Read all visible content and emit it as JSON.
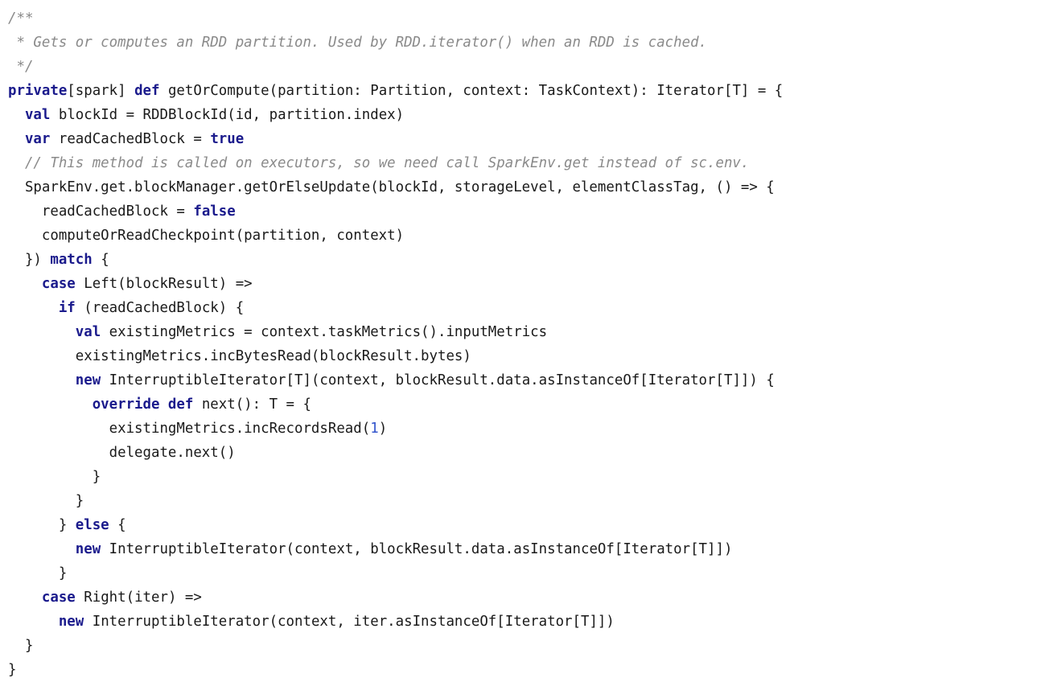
{
  "editor": {
    "language": "Scala",
    "background_color": "#ffffff",
    "colors": {
      "plain": "#1a1a1a",
      "keyword": "#1a1a8c",
      "number": "#3355cc",
      "comment": "#8a8a8a"
    }
  },
  "code": {
    "lines": [
      {
        "id": 1,
        "tokens": [
          {
            "t": "comment",
            "v": "/**"
          }
        ]
      },
      {
        "id": 2,
        "tokens": [
          {
            "t": "comment",
            "v": " * Gets or computes an RDD partition. Used by RDD.iterator() when an RDD is cached."
          }
        ]
      },
      {
        "id": 3,
        "tokens": [
          {
            "t": "comment",
            "v": " */"
          }
        ]
      },
      {
        "id": 4,
        "tokens": [
          {
            "t": "kw",
            "v": "private"
          },
          {
            "t": "plain",
            "v": "[spark] "
          },
          {
            "t": "kw",
            "v": "def"
          },
          {
            "t": "plain",
            "v": " getOrCompute(partition: Partition, context: TaskContext): Iterator[T] = {"
          }
        ]
      },
      {
        "id": 5,
        "tokens": [
          {
            "t": "plain",
            "v": "  "
          },
          {
            "t": "kw",
            "v": "val"
          },
          {
            "t": "plain",
            "v": " blockId = RDDBlockId(id, partition.index)"
          }
        ]
      },
      {
        "id": 6,
        "tokens": [
          {
            "t": "plain",
            "v": "  "
          },
          {
            "t": "kw",
            "v": "var"
          },
          {
            "t": "plain",
            "v": " readCachedBlock = "
          },
          {
            "t": "kw",
            "v": "true"
          }
        ]
      },
      {
        "id": 7,
        "tokens": [
          {
            "t": "plain",
            "v": "  "
          },
          {
            "t": "comment",
            "v": "// This method is called on executors, so we need call SparkEnv.get instead of sc.env."
          }
        ]
      },
      {
        "id": 8,
        "tokens": [
          {
            "t": "plain",
            "v": "  SparkEnv.get.blockManager.getOrElseUpdate(blockId, storageLevel, elementClassTag, () => {"
          }
        ]
      },
      {
        "id": 9,
        "tokens": [
          {
            "t": "plain",
            "v": "    readCachedBlock = "
          },
          {
            "t": "kw",
            "v": "false"
          }
        ]
      },
      {
        "id": 10,
        "tokens": [
          {
            "t": "plain",
            "v": "    computeOrReadCheckpoint(partition, context)"
          }
        ]
      },
      {
        "id": 11,
        "tokens": [
          {
            "t": "plain",
            "v": "  }) "
          },
          {
            "t": "kw",
            "v": "match"
          },
          {
            "t": "plain",
            "v": " {"
          }
        ]
      },
      {
        "id": 12,
        "tokens": [
          {
            "t": "plain",
            "v": "    "
          },
          {
            "t": "kw",
            "v": "case"
          },
          {
            "t": "plain",
            "v": " Left(blockResult) =>"
          }
        ]
      },
      {
        "id": 13,
        "tokens": [
          {
            "t": "plain",
            "v": "      "
          },
          {
            "t": "kw",
            "v": "if"
          },
          {
            "t": "plain",
            "v": " (readCachedBlock) {"
          }
        ]
      },
      {
        "id": 14,
        "tokens": [
          {
            "t": "plain",
            "v": "        "
          },
          {
            "t": "kw",
            "v": "val"
          },
          {
            "t": "plain",
            "v": " existingMetrics = context.taskMetrics().inputMetrics"
          }
        ]
      },
      {
        "id": 15,
        "tokens": [
          {
            "t": "plain",
            "v": "        existingMetrics.incBytesRead(blockResult.bytes)"
          }
        ]
      },
      {
        "id": 16,
        "tokens": [
          {
            "t": "plain",
            "v": "        "
          },
          {
            "t": "kw",
            "v": "new"
          },
          {
            "t": "plain",
            "v": " InterruptibleIterator[T](context, blockResult.data.asInstanceOf[Iterator[T]]) {"
          }
        ]
      },
      {
        "id": 17,
        "tokens": [
          {
            "t": "plain",
            "v": "          "
          },
          {
            "t": "kw",
            "v": "override def"
          },
          {
            "t": "plain",
            "v": " next(): T = {"
          }
        ]
      },
      {
        "id": 18,
        "tokens": [
          {
            "t": "plain",
            "v": "            existingMetrics.incRecordsRead("
          },
          {
            "t": "num",
            "v": "1"
          },
          {
            "t": "plain",
            "v": ")"
          }
        ]
      },
      {
        "id": 19,
        "tokens": [
          {
            "t": "plain",
            "v": "            delegate.next()"
          }
        ]
      },
      {
        "id": 20,
        "tokens": [
          {
            "t": "plain",
            "v": "          }"
          }
        ]
      },
      {
        "id": 21,
        "tokens": [
          {
            "t": "plain",
            "v": "        }"
          }
        ]
      },
      {
        "id": 22,
        "tokens": [
          {
            "t": "plain",
            "v": "      } "
          },
          {
            "t": "kw",
            "v": "else"
          },
          {
            "t": "plain",
            "v": " {"
          }
        ]
      },
      {
        "id": 23,
        "tokens": [
          {
            "t": "plain",
            "v": "        "
          },
          {
            "t": "kw",
            "v": "new"
          },
          {
            "t": "plain",
            "v": " InterruptibleIterator(context, blockResult.data.asInstanceOf[Iterator[T]])"
          }
        ]
      },
      {
        "id": 24,
        "tokens": [
          {
            "t": "plain",
            "v": "      }"
          }
        ]
      },
      {
        "id": 25,
        "tokens": [
          {
            "t": "plain",
            "v": "    "
          },
          {
            "t": "kw",
            "v": "case"
          },
          {
            "t": "plain",
            "v": " Right(iter) =>"
          }
        ]
      },
      {
        "id": 26,
        "tokens": [
          {
            "t": "plain",
            "v": "      "
          },
          {
            "t": "kw",
            "v": "new"
          },
          {
            "t": "plain",
            "v": " InterruptibleIterator(context, iter.asInstanceOf[Iterator[T]])"
          }
        ]
      },
      {
        "id": 27,
        "tokens": [
          {
            "t": "plain",
            "v": "  }"
          }
        ]
      },
      {
        "id": 28,
        "tokens": [
          {
            "t": "plain",
            "v": "}"
          }
        ]
      }
    ]
  }
}
